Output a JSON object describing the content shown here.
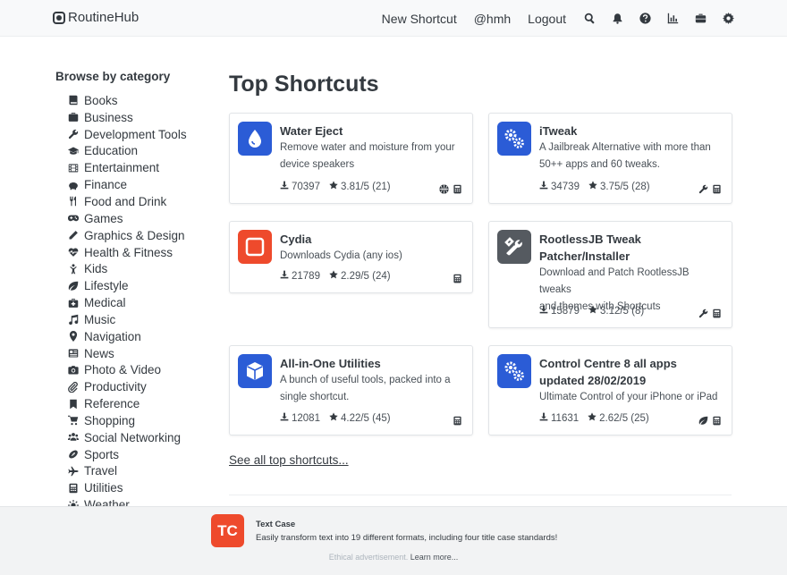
{
  "navbar": {
    "brand": "RoutineHub",
    "links": [
      "New Shortcut",
      "@hmh",
      "Logout"
    ],
    "icons": [
      "search-icon",
      "bell-icon",
      "help-icon",
      "chart-icon",
      "toolbox-icon",
      "gear-icon"
    ]
  },
  "sidebar": {
    "title": "Browse by category",
    "categories": [
      {
        "label": "Books",
        "icon": "book"
      },
      {
        "label": "Business",
        "icon": "briefcase"
      },
      {
        "label": "Development Tools",
        "icon": "wrench"
      },
      {
        "label": "Education",
        "icon": "graduation"
      },
      {
        "label": "Entertainment",
        "icon": "film"
      },
      {
        "label": "Finance",
        "icon": "piggy"
      },
      {
        "label": "Food and Drink",
        "icon": "utensils"
      },
      {
        "label": "Games",
        "icon": "gamepad"
      },
      {
        "label": "Graphics & Design",
        "icon": "pencil"
      },
      {
        "label": "Health & Fitness",
        "icon": "heartbeat"
      },
      {
        "label": "Kids",
        "icon": "child"
      },
      {
        "label": "Lifestyle",
        "icon": "leaf"
      },
      {
        "label": "Medical",
        "icon": "medkit"
      },
      {
        "label": "Music",
        "icon": "music"
      },
      {
        "label": "Navigation",
        "icon": "map-marker"
      },
      {
        "label": "News",
        "icon": "newspaper"
      },
      {
        "label": "Photo & Video",
        "icon": "camera"
      },
      {
        "label": "Productivity",
        "icon": "paperclip"
      },
      {
        "label": "Reference",
        "icon": "bookmark"
      },
      {
        "label": "Shopping",
        "icon": "cart"
      },
      {
        "label": "Social Networking",
        "icon": "users"
      },
      {
        "label": "Sports",
        "icon": "football"
      },
      {
        "label": "Travel",
        "icon": "plane"
      },
      {
        "label": "Utilities",
        "icon": "calculator"
      },
      {
        "label": "Weather",
        "icon": "sun"
      }
    ]
  },
  "main": {
    "title": "Top Shortcuts",
    "see_all": "See all top shortcuts..."
  },
  "cards": [
    {
      "title": "Water Eject",
      "title2": "",
      "desc1": "Remove water and moisture from your",
      "desc2": "device speakers",
      "downloads": "70397",
      "rating": "3.81/5 (21)",
      "icon": "water-drop",
      "icon_bg": "#2b5cd6",
      "tags": [
        "basketball",
        "calculator"
      ]
    },
    {
      "title": "iTweak",
      "title2": "",
      "desc1": "A Jailbreak Alternative with more than",
      "desc2": "50++ apps and 60 tweaks.",
      "downloads": "34739",
      "rating": "3.75/5 (28)",
      "icon": "cogs",
      "icon_bg": "#2b5cd6",
      "tags": [
        "wrench",
        "calculator"
      ]
    },
    {
      "title": "Cydia",
      "title2": "",
      "desc1": "Downloads Cydia (any ios)",
      "desc2": "",
      "downloads": "21789",
      "rating": "2.29/5 (24)",
      "icon": "square-outline",
      "icon_bg": "#ee4a2c",
      "tags": [
        "calculator"
      ]
    },
    {
      "title": "RootlessJB Tweak",
      "title2": "Patcher/Installer",
      "desc1": "Download and Patch RootlessJB tweaks",
      "desc2": "and themes with Shortcuts",
      "downloads": "15879",
      "rating": "3.12/5 (8)",
      "icon": "tools",
      "icon_bg": "#555a60",
      "tags": [
        "wrench",
        "calculator"
      ]
    },
    {
      "title": "All-in-One Utilities",
      "title2": "",
      "desc1": "A bunch of useful tools, packed into a",
      "desc2": "single shortcut.",
      "downloads": "12081",
      "rating": "4.22/5 (45)",
      "icon": "cube",
      "icon_bg": "#2b5cd6",
      "tags": [
        "calculator"
      ]
    },
    {
      "title": "Control Centre 8 all apps",
      "title2": "updated 28/02/2019",
      "desc1": "Ultimate Control of your iPhone or iPad",
      "desc2": "",
      "downloads": "11631",
      "rating": "2.62/5 (25)",
      "icon": "cogs",
      "icon_bg": "#2b5cd6",
      "tags": [
        "leaf",
        "calculator"
      ]
    }
  ],
  "ad": {
    "logo": "TC",
    "title": "Text Case",
    "text": "Easily transform text into 19 different formats, including four title case standards!",
    "footer_prefix": "Ethical advertisement.",
    "footer_link": "Learn more..."
  }
}
